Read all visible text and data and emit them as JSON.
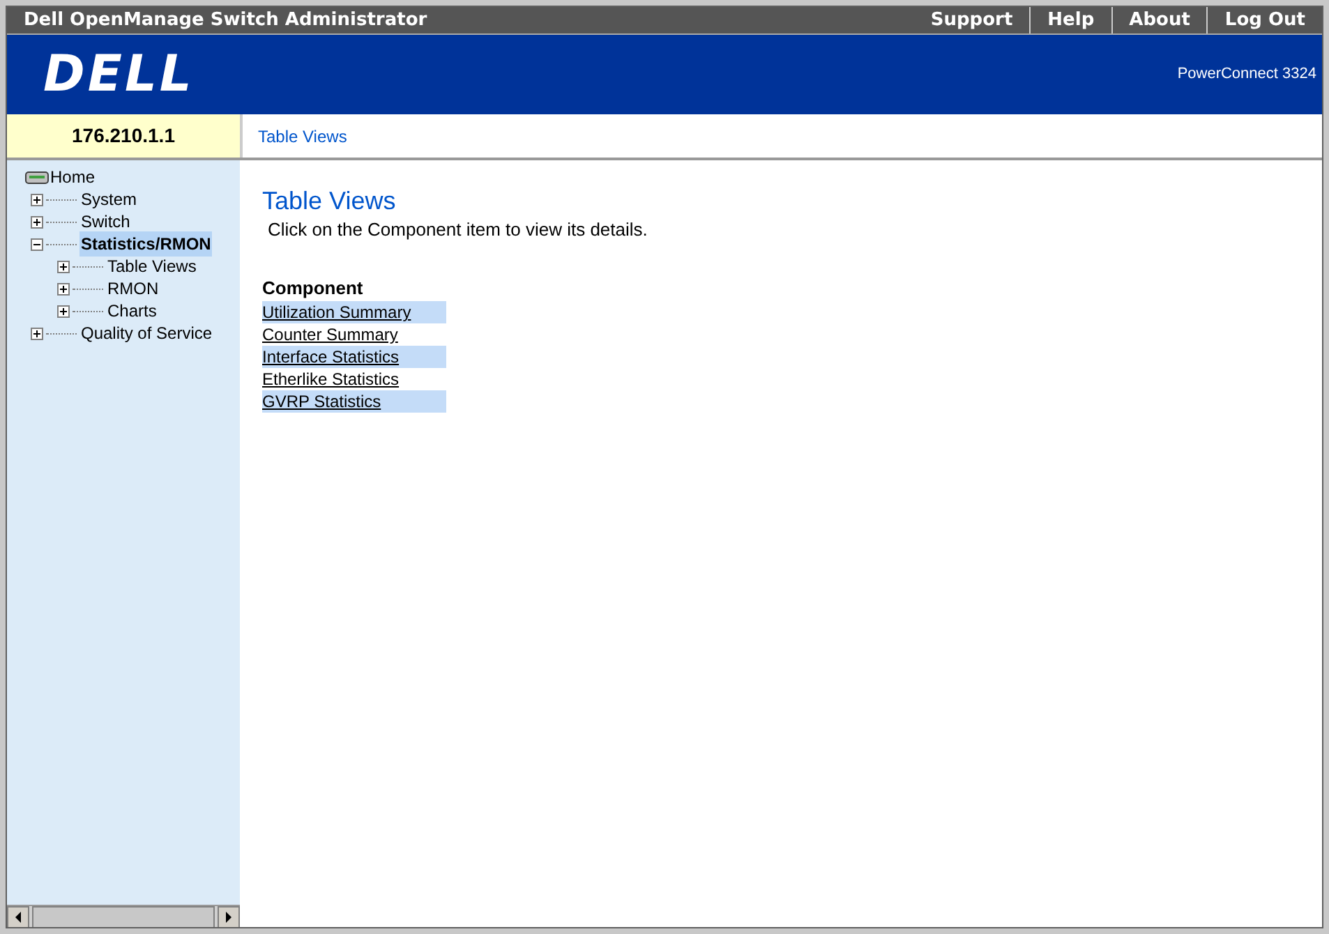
{
  "app_title": "Dell OpenManage Switch Administrator",
  "top_links": [
    "Support",
    "Help",
    "About",
    "Log Out"
  ],
  "logo": "DELL",
  "product": "PowerConnect 3324",
  "device_ip": "176.210.1.1",
  "breadcrumb": "Table Views",
  "tree": {
    "label": "Home",
    "children": [
      {
        "label": "System",
        "expanded": false,
        "selected": false
      },
      {
        "label": "Switch",
        "expanded": false,
        "selected": false
      },
      {
        "label": "Statistics/RMON",
        "expanded": true,
        "selected": true,
        "children": [
          {
            "label": "Table Views",
            "expanded": false,
            "selected": false
          },
          {
            "label": "RMON",
            "expanded": false,
            "selected": false
          },
          {
            "label": "Charts",
            "expanded": false,
            "selected": false
          }
        ]
      },
      {
        "label": "Quality of Service",
        "expanded": false,
        "selected": false
      }
    ]
  },
  "page": {
    "title": "Table Views",
    "instruction": "Click on the Component item to view its details.",
    "column_header": "Component",
    "components": [
      "Utilization Summary",
      "Counter Summary",
      "Interface Statistics",
      "Etherlike Statistics",
      "GVRP Statistics"
    ]
  }
}
